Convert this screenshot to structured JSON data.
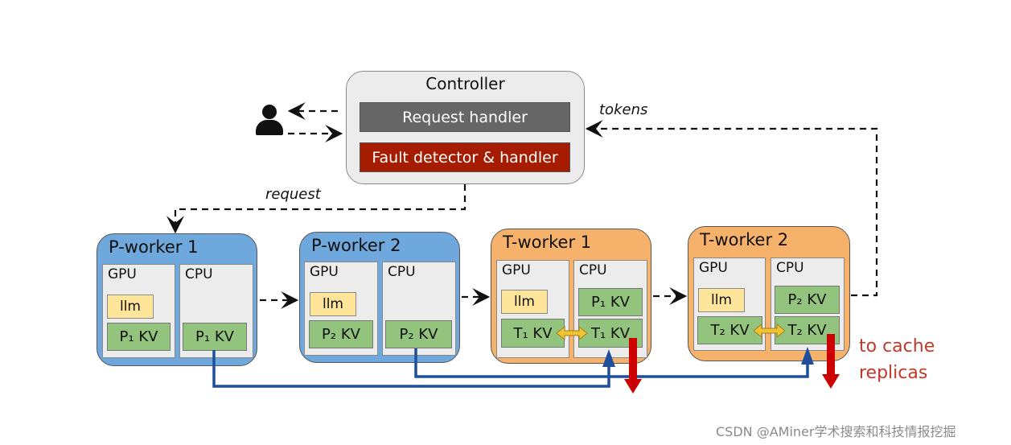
{
  "controller": {
    "title": "Controller",
    "request_handler": "Request handler",
    "fault_handler": "Fault detector & handler"
  },
  "labels": {
    "tokens": "tokens",
    "request": "request",
    "to_cache_1": "to cache",
    "to_cache_2": "replicas"
  },
  "workers": [
    {
      "title": "P-worker 1",
      "gpu": "GPU",
      "cpu": "CPU",
      "llm": "llm",
      "gpu_kv": "P₁ KV",
      "cpu_kv": "P₁ KV"
    },
    {
      "title": "P-worker 2",
      "gpu": "GPU",
      "cpu": "CPU",
      "llm": "llm",
      "gpu_kv": "P₂ KV",
      "cpu_kv": "P₂ KV"
    },
    {
      "title": "T-worker 1",
      "gpu": "GPU",
      "cpu": "CPU",
      "llm": "llm",
      "gpu_kv": "T₁ KV",
      "cpu_kv_top": "P₁ KV",
      "cpu_kv": "T₁ KV"
    },
    {
      "title": "T-worker 2",
      "gpu": "GPU",
      "cpu": "CPU",
      "llm": "llm",
      "gpu_kv": "T₂ KV",
      "cpu_kv_top": "P₂ KV",
      "cpu_kv": "T₂ KV"
    }
  ],
  "watermark": "CSDN @AMiner学术搜索和科技情报挖掘",
  "colors": {
    "p_worker": "#6fa8dc",
    "t_worker": "#f6b26b",
    "request_handler": "#666666",
    "fault_handler": "#a61c00",
    "kv": "#93c47d",
    "llm": "#ffe599",
    "transfer": "#1f4e9a",
    "replica": "#cc0000",
    "swap": "#f1c232"
  },
  "icons": {
    "user": "user-icon"
  }
}
